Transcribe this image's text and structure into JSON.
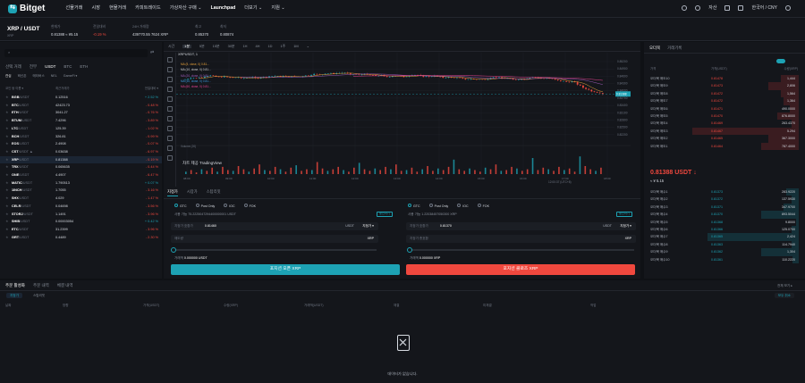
{
  "nav": {
    "brand": "Bitget",
    "items": [
      {
        "label": "선물거래",
        "hot": "HOT"
      },
      {
        "label": "시장"
      },
      {
        "label": "현물거래"
      },
      {
        "label": "카피트레이드"
      },
      {
        "label": "가상자산 구매 ⌄"
      },
      {
        "label": "Launchpad",
        "hot": "NEW"
      },
      {
        "label": "더보기 ⌄"
      },
      {
        "label": "지원 ⌄"
      }
    ],
    "asset": "자산",
    "lang": "한국어 / CNY"
  },
  "ticker": {
    "pair": "XRP / USDT",
    "sub": "XRP",
    "price_label": "현재가",
    "price": "0.81388 ≈ ¥5.15",
    "change_label": "전일대비",
    "change": "-0.19 %",
    "vol_label": "24H 거래량",
    "vol": "439770.55 7624 XRP",
    "high_label": "최고",
    "high": "0.85370",
    "low_label": "최저",
    "low": "0.80874"
  },
  "left": {
    "search": "",
    "tabs": [
      "선택 거래",
      "전부",
      "USDT",
      "BTC",
      "ETH"
    ],
    "subtabs": [
      "관심",
      "혁신존",
      "메타버스",
      "NEL",
      "GameFi ▾"
    ],
    "col_pair": "코인 쌍 이름 ▾",
    "col_price": "최근거래가",
    "col_change": "전일대비 ▾",
    "rows": [
      {
        "n": "BGB",
        "q": "/USDT",
        "p": "0.12516",
        "c": "+ 2.52 %"
      },
      {
        "n": "BTC",
        "q": "/USDT",
        "p": "42423.73",
        "c": "- 0.48 %"
      },
      {
        "n": "ETH",
        "q": "/USDT",
        "p": "3041.27",
        "c": "- 0.76 %"
      },
      {
        "n": "BTUM",
        "q": "/USDT",
        "p": "7.4296",
        "c": "- 3.89 %"
      },
      {
        "n": "LTC",
        "q": "/USDT",
        "p": "125.39",
        "c": "- 1.02 %"
      },
      {
        "n": "BCH",
        "q": "/USDT",
        "p": "326.81",
        "c": "- 0.99 %"
      },
      {
        "n": "EOS",
        "q": "/USDT",
        "p": "2.4908",
        "c": "- 0.07 %"
      },
      {
        "n": "CST",
        "q": "/USDT ▲",
        "p": "0.03638",
        "c": "- 6.97 %"
      },
      {
        "n": "XRP",
        "q": "/USDT",
        "p": "0.81388",
        "c": "- 0.19 %"
      },
      {
        "n": "TRX",
        "q": "/USDT",
        "p": "0.065635",
        "c": "- 0.44 %"
      },
      {
        "n": "ONE",
        "q": "/USDT",
        "p": "4.4907",
        "c": "- 6.47 %"
      },
      {
        "n": "MATIC",
        "q": "/USDT",
        "p": "1.790513",
        "c": "+ 0.07 %"
      },
      {
        "n": "1INCH",
        "q": "/USDT",
        "p": "1.7055",
        "c": "- 3.16 %"
      },
      {
        "n": "SHX",
        "q": "/USDT",
        "p": "4.029",
        "c": "- 1.47 %"
      },
      {
        "n": "CELR",
        "q": "/USDT",
        "p": "0.04698",
        "c": "- 3.56 %"
      },
      {
        "n": "STORJ",
        "q": "/USDT",
        "p": "1.1491",
        "c": "- 3.96 %"
      },
      {
        "n": "SHIB",
        "q": "/USDT",
        "p": "0.00003054",
        "c": "+ 0.42 %"
      },
      {
        "n": "ETC",
        "q": "/USDT",
        "p": "31.2399",
        "c": "- 3.96 %"
      },
      {
        "n": "GRT",
        "q": "/USDT",
        "p": "0.4489",
        "c": "- 2.30 %"
      }
    ]
  },
  "chart": {
    "intervals": [
      "시간",
      "1분",
      "5분",
      "15분",
      "30분",
      "1H",
      "4H",
      "1D",
      "1주",
      "1M",
      "⌄"
    ],
    "active": "1분",
    "series_label": "XRPUSDT, 1",
    "legend": [
      "MA (5, close, 0) 0.81...",
      "MA (10, close, 0) 0.81...",
      "MA (20, close, 0) 0.81...",
      "MA (30, close, 0) 0.81...",
      "MA (60, close, 0) 0.81..."
    ],
    "volume_label": "Volume (20)",
    "tv": "차트 제공 TradingView",
    "price_ticks": [
      "0.85200",
      "0.84900",
      "0.84600",
      "0.84300",
      "0.84000",
      "0.83700",
      "0.83400",
      "0.83100",
      "0.82800",
      "0.82500",
      "0.82200"
    ],
    "last_price": "0.81388",
    "time_ticks": [
      "08:00",
      "09:00",
      "10:00",
      "11:00",
      "12:00",
      "13:00",
      "14:00",
      "15:00",
      "16:00",
      "17:00",
      "18:00"
    ],
    "footer": "12:00:37 (UTC+8)",
    "vol_values": [
      3,
      5,
      2,
      6,
      4,
      8,
      3,
      9,
      5,
      4,
      10,
      6,
      3,
      7,
      12,
      5,
      4,
      9,
      6,
      3,
      8,
      11,
      4,
      6,
      5,
      15,
      7,
      4,
      6,
      9,
      5,
      3,
      8,
      14,
      6,
      4,
      7,
      5,
      9,
      6,
      12,
      4,
      5,
      8,
      3,
      6,
      10,
      4,
      7,
      5,
      9,
      18,
      6,
      4,
      7,
      5,
      3,
      8,
      6,
      12,
      4,
      5,
      9,
      7,
      4,
      6,
      20,
      5,
      8,
      6,
      4,
      9,
      5,
      7,
      3,
      22,
      10,
      6,
      4,
      8
    ]
  },
  "order": {
    "tabs": [
      "지정가",
      "시장가",
      "스탑리밋"
    ],
    "types": [
      "GTC",
      "Post Only",
      "IOC",
      "FOK"
    ],
    "buy_avail": "사용 가능 75.2225047294400000001 USDT",
    "sell_avail": "사용 가능 1.22038457050300 XRP",
    "deposit": "충전하기",
    "price_label": "지정가 호환가",
    "buy_price": "0.81460",
    "sell_price": "0.81370",
    "unit": "USDT",
    "limit": "지정가 ▾",
    "qty_label": "매도량",
    "qty_label2": "지정가 총호환",
    "qty_unit": "XRP",
    "buy_total": "0.000000 USDT",
    "sell_total": "0.000000 XRP",
    "total_label": "거래액",
    "buy_btn": "포지션 오픈 XRP",
    "sell_btn": "포지션 클로즈 XRP",
    "buy_btn_color": "#1da2b4",
    "sell_btn_color": "#f0483e"
  },
  "book": {
    "tabs": [
      "오더북",
      "거래기록"
    ],
    "cols": [
      "가격",
      "가격(USDT)",
      "수량(XRP)"
    ],
    "asks": [
      {
        "l": "오더북 매도10",
        "p": "0.81478",
        "a": "1,444"
      },
      {
        "l": "오더북 매도9",
        "p": "0.81473",
        "a": "2,806"
      },
      {
        "l": "오더북 매도8",
        "p": "0.81472",
        "a": "1,564"
      },
      {
        "l": "오더북 매도7",
        "p": "0.81472",
        "a": "1,364"
      },
      {
        "l": "오더북 매도6",
        "p": "0.81471",
        "a": "490.0000"
      },
      {
        "l": "오더북 매도5",
        "p": "0.81470",
        "a": "876.8000"
      },
      {
        "l": "오더북 매도4",
        "p": "0.81469",
        "a": "263.4370"
      },
      {
        "l": "오더북 매도3",
        "p": "0.81467",
        "a": "5.294"
      },
      {
        "l": "오더북 매도2",
        "p": "0.81465",
        "a": "367.3000"
      },
      {
        "l": "오더북 매도1",
        "p": "0.81464",
        "a": "787.4000"
      }
    ],
    "mid": "0.81388 USDT ↓",
    "mid_sub": "≈ ¥ 5.15",
    "bids": [
      {
        "l": "오더북 매수1",
        "p": "0.81373",
        "a": "283.9220"
      },
      {
        "l": "오더북 매수2",
        "p": "0.81372",
        "a": "137.5930"
      },
      {
        "l": "오더북 매수3",
        "p": "0.81371",
        "a": "347.9700"
      },
      {
        "l": "오더북 매수4",
        "p": "0.81370",
        "a": "893.5044"
      },
      {
        "l": "오더북 매수5",
        "p": "0.81368",
        "a": "9.8000"
      },
      {
        "l": "오더북 매수6",
        "p": "0.81366",
        "a": "125.0700"
      },
      {
        "l": "오더북 매수7",
        "p": "0.81365",
        "a": "2,424"
      },
      {
        "l": "오더북 매수8",
        "p": "0.81363",
        "a": "114.7940"
      },
      {
        "l": "오더북 매수9",
        "p": "0.81362",
        "a": "1,304"
      },
      {
        "l": "오더북 매수10",
        "p": "0.81361",
        "a": "110.2220"
      }
    ]
  },
  "bottom": {
    "tabs": [
      "주문 활성화",
      "주문 내역",
      "체결 내역"
    ],
    "sub": [
      "지정가",
      "스탑리밋"
    ],
    "show_all": "전체 보기 ▸",
    "cancel_all": "모두 취소",
    "cols": [
      "날짜",
      "방향",
      "가격(USDT)",
      "수량(XRP)",
      "거래액(USDT)",
      "체결",
      "미체결",
      "작업"
    ],
    "empty": "데이터가 없습니다."
  }
}
